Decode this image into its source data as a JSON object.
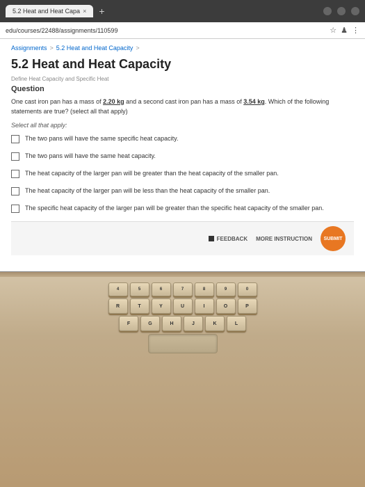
{
  "browser": {
    "tab_title": "5.2 Heat and Heat Capa",
    "tab_close": "×",
    "tab_add": "+",
    "address": "edu/courses/22488/assignments/110599",
    "controls": [
      "minimize",
      "maximize",
      "close"
    ]
  },
  "breadcrumb": {
    "assignments_label": "Assignments",
    "separator": ">",
    "current_label": "5.2 Heat and Heat Capacity",
    "current_separator": ">"
  },
  "page": {
    "title": "5.2 Heat and Heat Capacity",
    "subtitle": "Define Heat Capacity and Specific Heat",
    "question_label": "Question",
    "question_text_part1": "One cast iron pan has a mass of ",
    "mass1": "2.20 kg",
    "question_text_part2": " and a second cast iron pan has a mass of ",
    "mass2": "3.54 kg",
    "question_text_part3": ". Which of the following statements are true? (select all that apply)",
    "select_all_text": "Select all that apply:",
    "options": [
      "The two pans will have the same specific heat capacity.",
      "The two pans will have the same heat capacity.",
      "The heat capacity of the larger pan will be greater than the heat capacity of the smaller pan.",
      "The heat capacity of the larger pan will be less than the heat capacity of the smaller pan.",
      "The specific heat capacity of the larger pan will be greater than the specific heat capacity of the smaller pan."
    ]
  },
  "bottom_bar": {
    "feedback_label": "FEEDBACK",
    "more_instruction_label": "MORE INSTRUCTION",
    "submit_label": "SUBMIT"
  },
  "keyboard": {
    "num_row": [
      "4",
      "5",
      "6",
      "7",
      "8",
      "9",
      "0"
    ],
    "row1": [
      "R",
      "T",
      "Y",
      "U",
      "I",
      "O",
      "P"
    ],
    "row2": [
      "F",
      "G",
      "H",
      "J",
      "K",
      "L"
    ]
  }
}
